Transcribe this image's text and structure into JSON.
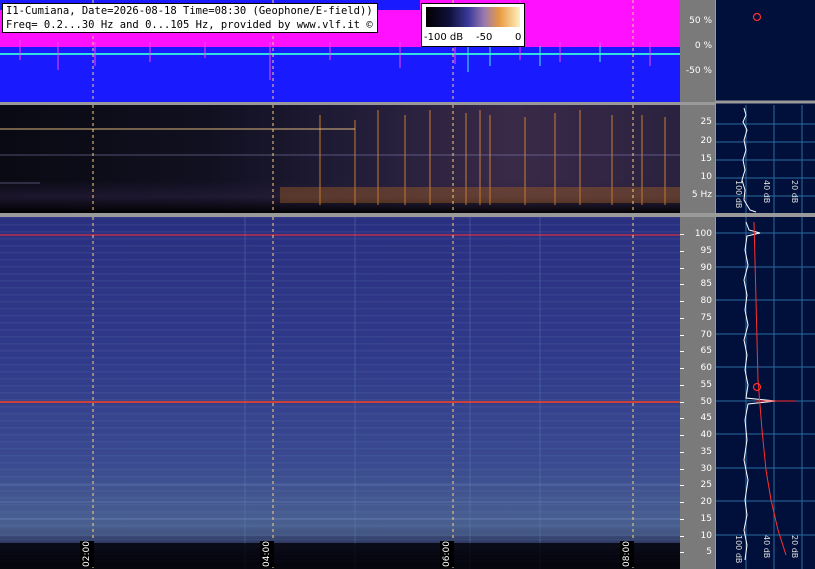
{
  "header": {
    "title": "I1-Cumiana, Date=2026-08-18 Time=08:30 (Geophone/E-field))",
    "freq_info": "Freq= 0.2...30 Hz and 0...105 Hz, provided by www.vlf.it ©"
  },
  "colorbar": {
    "labels": [
      "-100 dB",
      "-50",
      "0"
    ]
  },
  "waveform_axis": [
    "50 %",
    "0 %",
    "-50 %"
  ],
  "geophone_axis": [
    "25",
    "20",
    "15",
    "10",
    "5 Hz"
  ],
  "efield_axis": [
    "100",
    "95",
    "90",
    "85",
    "80",
    "75",
    "70",
    "65",
    "60",
    "55",
    "50",
    "45",
    "40",
    "35",
    "30",
    "25",
    "20",
    "15",
    "10",
    "5"
  ],
  "time_labels": [
    "02:00",
    "04:00",
    "06:00",
    "08:00"
  ],
  "profile": {
    "db_labels": [
      "100 dB",
      "40 dB",
      "20 dB"
    ]
  },
  "colors": {
    "waveform_bg": "#1a1aff",
    "waveform_envelope": "#ff10ff",
    "waveform_trace": "#30e0e0",
    "time_marker": "#ffd080",
    "mains_line": "#ff3030",
    "axis_bg": "#7a7a7a"
  }
}
